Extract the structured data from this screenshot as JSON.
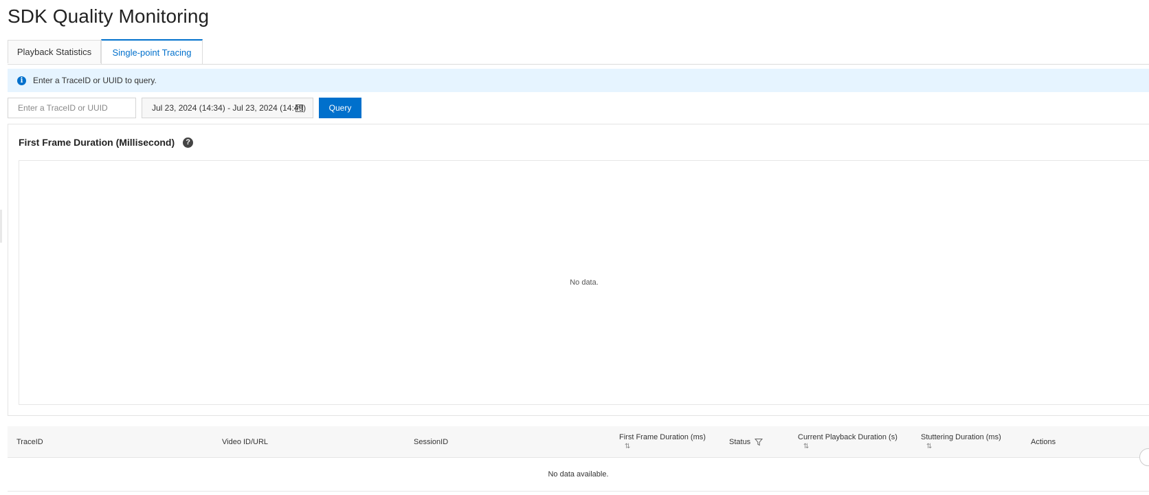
{
  "page": {
    "title": "SDK Quality Monitoring"
  },
  "tabs": [
    {
      "label": "Playback Statistics",
      "active": false
    },
    {
      "label": "Single-point Tracing",
      "active": true
    }
  ],
  "alert": {
    "icon": "info-icon",
    "text": "Enter a TraceID or UUID to query."
  },
  "search": {
    "placeholder": "Enter a TraceID or UUID",
    "value": ""
  },
  "date_range": {
    "value": "Jul 23, 2024 (14:34) - Jul 23, 2024 (14:49)",
    "icon": "calendar-icon"
  },
  "query_button": {
    "label": "Query"
  },
  "chart": {
    "title": "First Frame Duration (Millisecond)",
    "help_icon": "?",
    "empty_text": "No data."
  },
  "table": {
    "columns": [
      {
        "label": "TraceID",
        "sortable": false,
        "filterable": false
      },
      {
        "label": "Video ID/URL",
        "sortable": false,
        "filterable": false
      },
      {
        "label": "SessionID",
        "sortable": false,
        "filterable": false
      },
      {
        "label": "First Frame Duration (ms)",
        "sortable": true,
        "filterable": false
      },
      {
        "label": "Status",
        "sortable": false,
        "filterable": true
      },
      {
        "label": "Current Playback Duration (s)",
        "sortable": true,
        "filterable": false
      },
      {
        "label": "Stuttering Duration (ms)",
        "sortable": true,
        "filterable": false
      },
      {
        "label": "Actions",
        "sortable": false,
        "filterable": false
      }
    ],
    "empty_text": "No data available.",
    "sort_icon": "⇅"
  },
  "colors": {
    "accent": "#0070cc",
    "alert_bg": "#e6f4ff",
    "header_bg": "#f7f7f7"
  }
}
